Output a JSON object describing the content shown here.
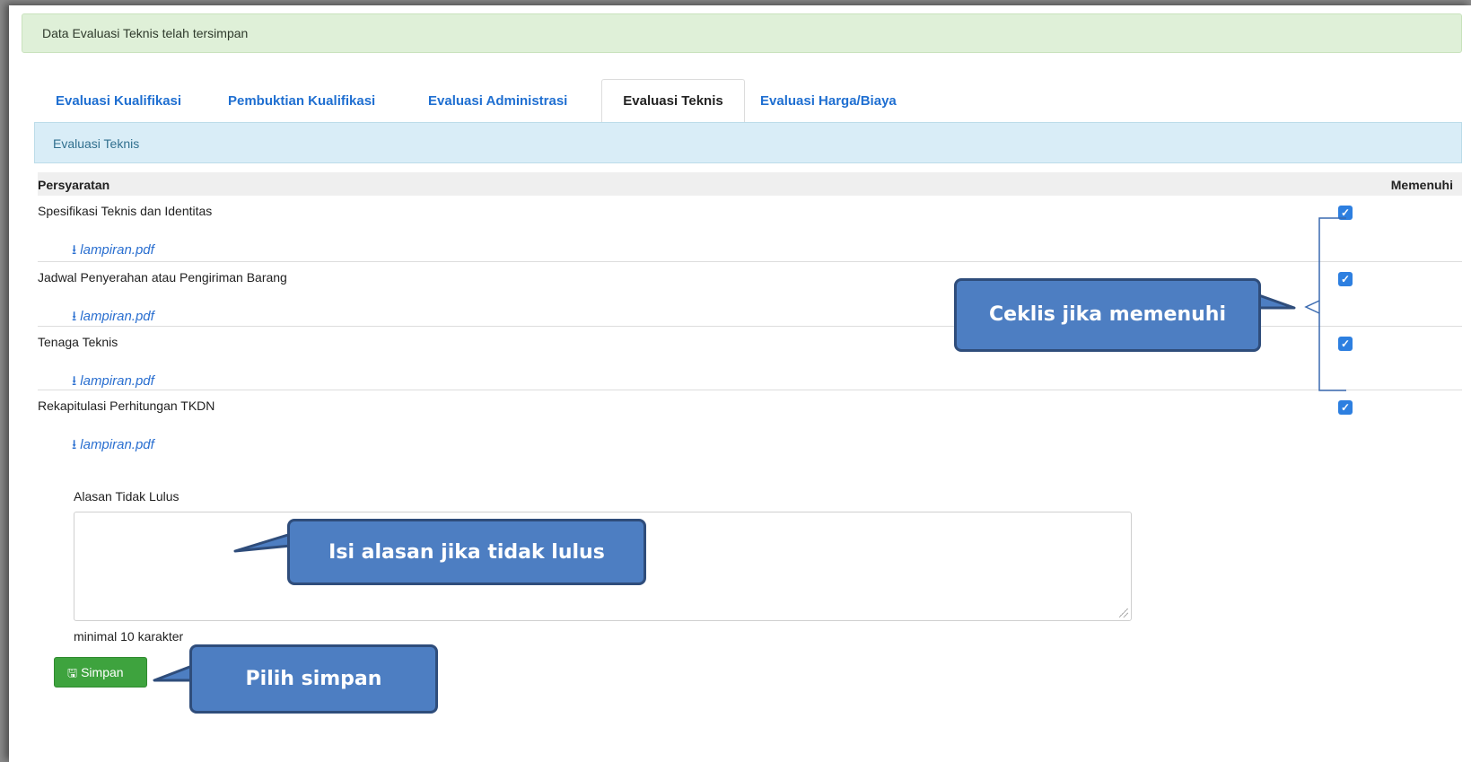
{
  "alert": {
    "text": "Data Evaluasi Teknis telah tersimpan"
  },
  "tabs": [
    {
      "label": "Evaluasi Kualifikasi",
      "active": false
    },
    {
      "label": "Pembuktian Kualifikasi",
      "active": false
    },
    {
      "label": "Evaluasi Administrasi",
      "active": false
    },
    {
      "label": "Evaluasi Teknis",
      "active": true
    },
    {
      "label": "Evaluasi Harga/Biaya",
      "active": false
    }
  ],
  "panel": {
    "title": "Evaluasi Teknis"
  },
  "table": {
    "col_requirement": "Persyaratan",
    "col_meets": "Memenuhi",
    "rows": [
      {
        "title": "Spesifikasi Teknis dan Identitas",
        "attachment": "lampiran.pdf",
        "checked": true
      },
      {
        "title": "Jadwal Penyerahan atau Pengiriman Barang",
        "attachment": "lampiran.pdf",
        "checked": true
      },
      {
        "title": "Tenaga Teknis",
        "attachment": "lampiran.pdf",
        "checked": true
      },
      {
        "title": "Rekapitulasi Perhitungan TKDN",
        "attachment": "lampiran.pdf",
        "checked": true
      }
    ]
  },
  "reason": {
    "label": "Alasan Tidak Lulus",
    "value": "",
    "hint": "minimal 10 karakter"
  },
  "save_button": {
    "label": "Simpan",
    "icon": "floppy-disk-icon",
    "color": "#3ea33e"
  },
  "callouts": {
    "check": "Ceklis jika memenuhi",
    "reason": "Isi alasan jika tidak lulus",
    "save": "Pilih simpan"
  },
  "colors": {
    "link": "#1f6fd1",
    "checkbox": "#2d7fe0",
    "callout_fill": "#4d7ec2",
    "callout_border": "#2f4d7b"
  }
}
